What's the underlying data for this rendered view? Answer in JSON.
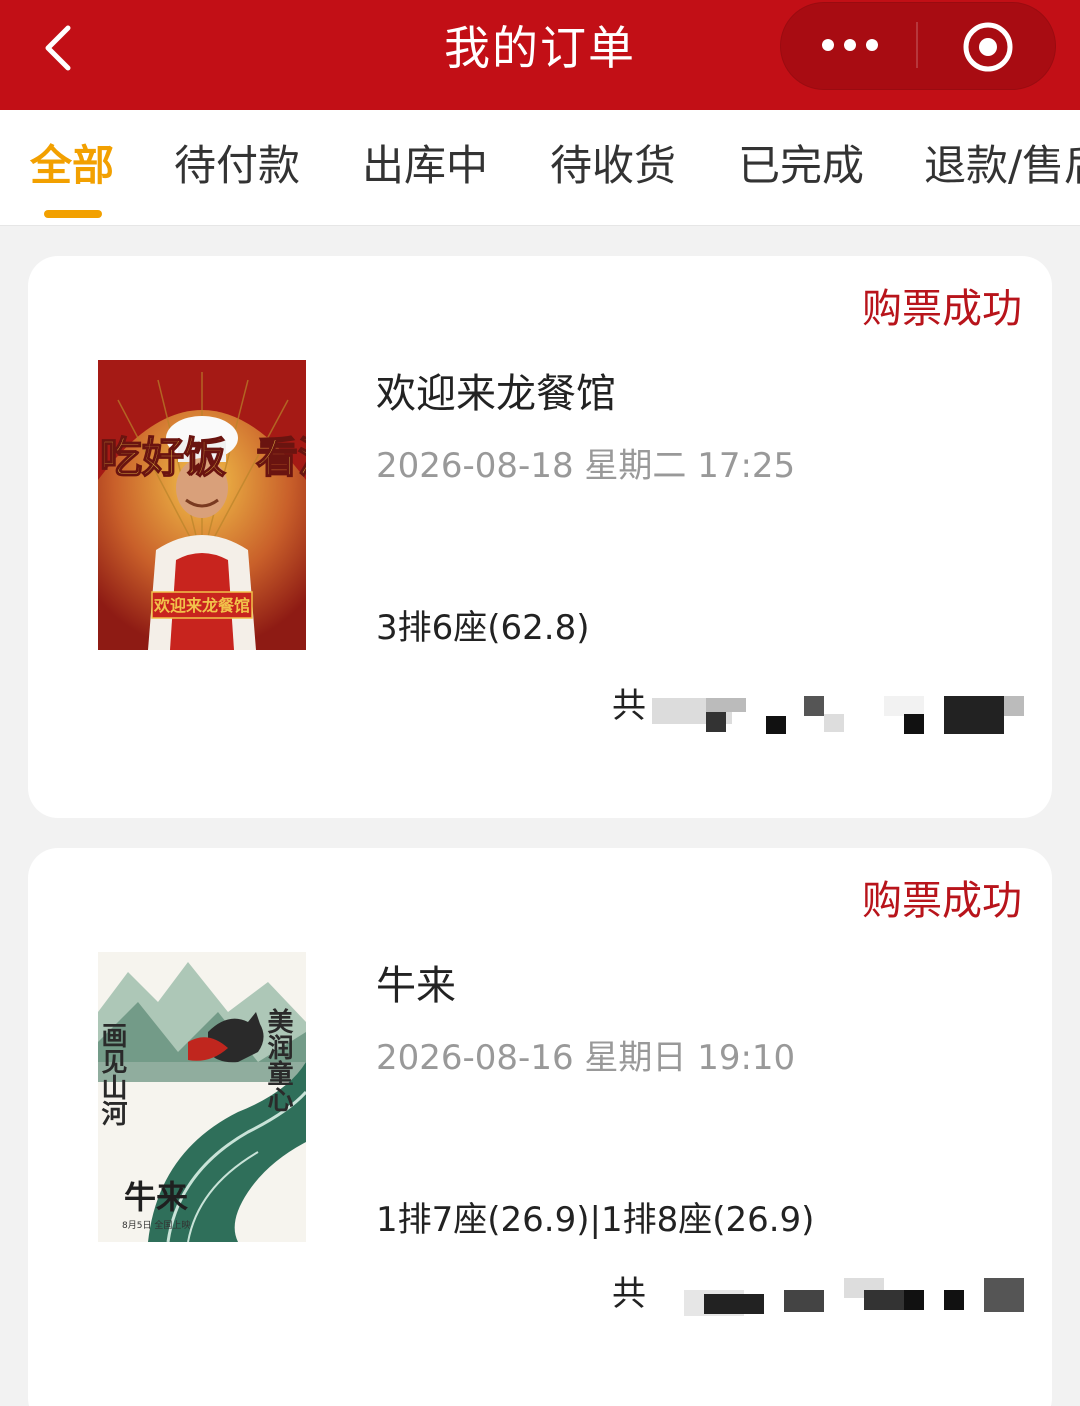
{
  "header": {
    "title": "我的订单"
  },
  "tabs": [
    {
      "label": "全部",
      "active": true
    },
    {
      "label": "待付款"
    },
    {
      "label": "出库中"
    },
    {
      "label": "待收货"
    },
    {
      "label": "已完成"
    },
    {
      "label": "退款/售后"
    }
  ],
  "orders": [
    {
      "status": "购票成功",
      "movie": "欢迎来龙餐馆",
      "showtime": "2026-08-18 星期二 17:25",
      "seats": "3排6座(62.8)",
      "total_prefix": "共",
      "poster": {
        "left_text": "吃好饭",
        "right_text": "看沈腾"
      }
    },
    {
      "status": "购票成功",
      "movie": "牛来",
      "showtime": "2026-08-16 星期日 19:10",
      "seats": "1排7座(26.9)|1排8座(26.9)",
      "total_prefix": "共",
      "poster": {
        "left_text": "画见山河",
        "right_text": "美润童心",
        "bottom_text": "牛来",
        "date_text": "8月5日 全国上映"
      }
    }
  ],
  "colors": {
    "header_bg": "#c20f16",
    "accent": "#f2a000",
    "status": "#b8141b"
  }
}
